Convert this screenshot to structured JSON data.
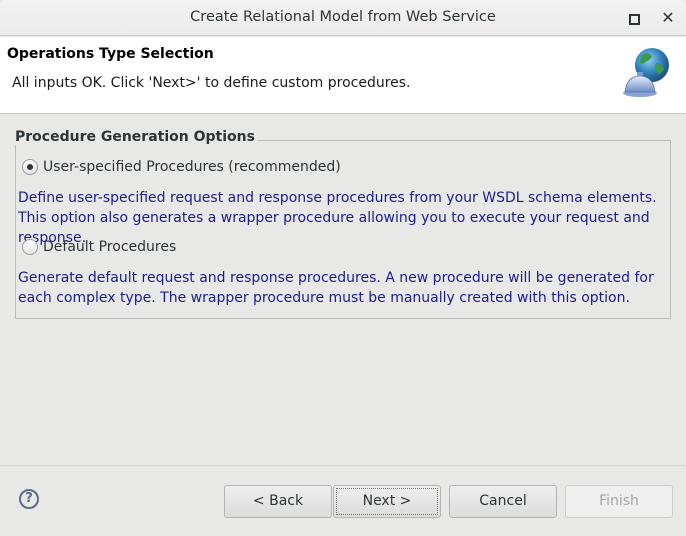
{
  "window": {
    "title": "Create Relational Model from Web Service",
    "controls": {
      "maximize_icon": "maximize-icon",
      "close_icon": "close-icon",
      "close_glyph": "✕"
    }
  },
  "header": {
    "title": "Operations Type Selection",
    "message": "All inputs OK. Click 'Next>' to define custom procedures.",
    "banner_icon": "globe-service-bell-icon"
  },
  "options_group": {
    "label": "Procedure Generation Options",
    "options": [
      {
        "label": "User-specified Procedures (recommended)",
        "checked": true,
        "description": "Define user-specified request and response procedures from your WSDL schema elements. This option also generates a wrapper procedure allowing you to execute your request and response."
      },
      {
        "label": "Default Procedures",
        "checked": false,
        "description": "Generate default request and response procedures. A new procedure will be generated for each complex type. The wrapper procedure must be manually created with this option."
      }
    ]
  },
  "footer": {
    "help_glyph": "?",
    "buttons": {
      "back": "< Back",
      "next": "Next >",
      "cancel": "Cancel",
      "finish": "Finish"
    },
    "finish_enabled": false
  },
  "colors": {
    "description_text": "#1c1c8c",
    "help_icon": "#5b6b8c"
  }
}
